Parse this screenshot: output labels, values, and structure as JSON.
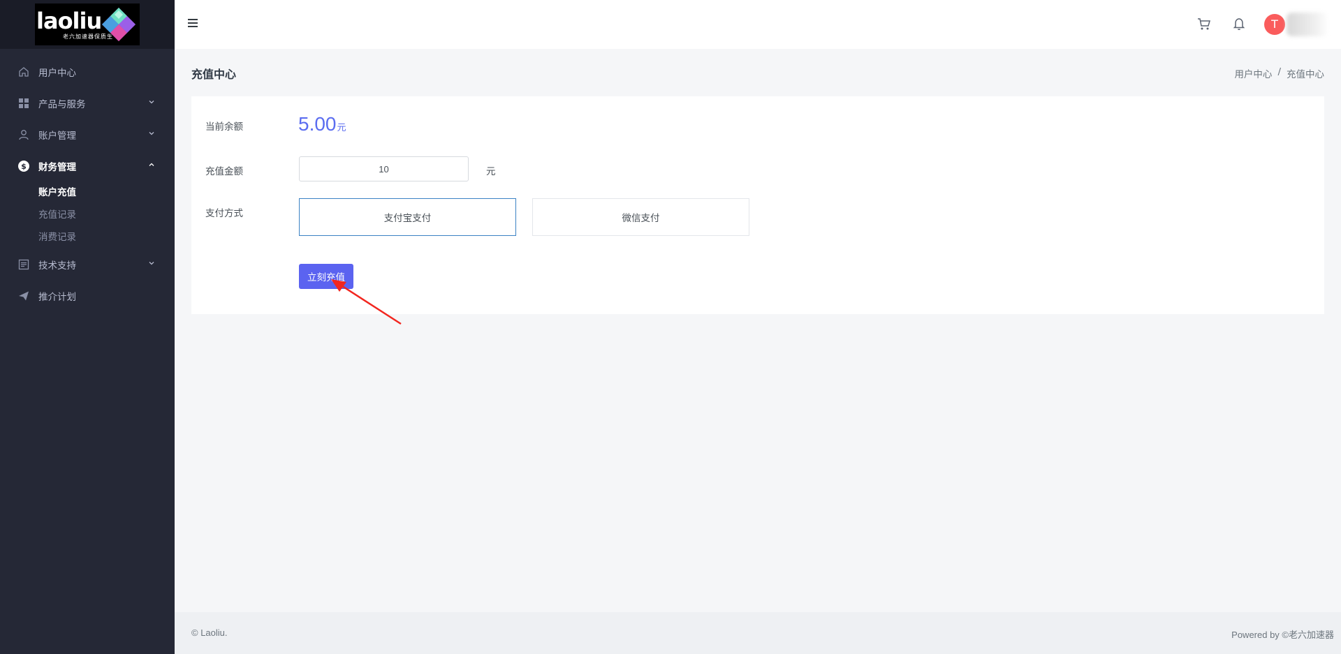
{
  "brand": {
    "logo_text": "laoliu",
    "logo_subtitle": "老六加速器保质生",
    "accent_color": "#5b63f0"
  },
  "sidebar": {
    "items": [
      {
        "label": "用户中心",
        "icon": "home-icon"
      },
      {
        "label": "产品与服务",
        "icon": "grid-icon"
      },
      {
        "label": "账户管理",
        "icon": "user-icon"
      },
      {
        "label": "财务管理",
        "icon": "dollar-icon"
      },
      {
        "label": "技术支持",
        "icon": "document-icon"
      },
      {
        "label": "推介计划",
        "icon": "send-icon"
      }
    ],
    "finance_sub": [
      {
        "label": "账户充值"
      },
      {
        "label": "充值记录"
      },
      {
        "label": "消费记录"
      }
    ]
  },
  "topbar": {
    "avatar_initial": "T"
  },
  "page": {
    "title": "充值中心",
    "breadcrumb": [
      "用户中心",
      "/",
      "充值中心"
    ]
  },
  "form": {
    "balance_label": "当前余额",
    "balance_value": "5.00",
    "balance_unit": "元",
    "amount_label": "充值金额",
    "amount_value": "10",
    "amount_unit": "元",
    "payment_label": "支付方式",
    "payment_options": [
      "支付宝支付",
      "微信支付"
    ],
    "selected_payment": "支付宝支付",
    "submit_label": "立刻充值"
  },
  "footer": {
    "copyright": "© Laoliu.",
    "powered": "Powered by ©老六加速器"
  }
}
